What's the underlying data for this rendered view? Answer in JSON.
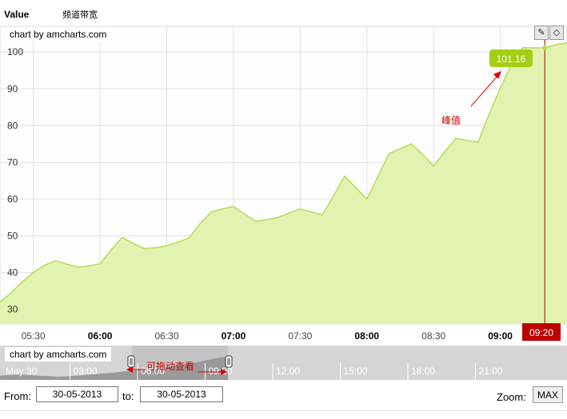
{
  "header": {
    "value_label": "Value",
    "legend_series": "频道带宽"
  },
  "credits": {
    "main": "chart by amcharts.com",
    "scroller": "chart by amcharts.com"
  },
  "tools": {
    "draw_icon": "pencil-icon",
    "erase_icon": "eraser-icon"
  },
  "annotations": {
    "peak_text": "峰值",
    "drag_text": "可拖动查看"
  },
  "cursor": {
    "time_label": "09:20",
    "value_label": "101.16"
  },
  "controls": {
    "from_label": "From:",
    "from_value": "30-05-2013",
    "to_label": "to:",
    "to_value": "30-05-2013",
    "zoom_label": "Zoom:",
    "max_label": "MAX"
  },
  "colors": {
    "area_fill": "#e2f2b0",
    "line": "#b7dc5a",
    "balloon": "#a2cf13",
    "cursor": "#aa0000",
    "annotation": "#dd0000"
  },
  "chart_data": {
    "type": "area",
    "series": [
      {
        "name": "频道带宽",
        "x": [
          "05:15",
          "05:20",
          "05:25",
          "05:30",
          "05:35",
          "05:40",
          "05:45",
          "05:50",
          "05:55",
          "06:00",
          "06:05",
          "06:10",
          "06:15",
          "06:20",
          "06:25",
          "06:30",
          "06:35",
          "06:40",
          "06:45",
          "06:50",
          "06:55",
          "07:00",
          "07:05",
          "07:10",
          "07:15",
          "07:20",
          "07:25",
          "07:30",
          "07:35",
          "07:40",
          "07:45",
          "07:50",
          "07:55",
          "08:00",
          "08:05",
          "08:10",
          "08:15",
          "08:20",
          "08:25",
          "08:30",
          "08:35",
          "08:40",
          "08:45",
          "08:50",
          "08:55",
          "09:00",
          "09:05",
          "09:10",
          "09:15",
          "09:20",
          "09:25",
          "09:30"
        ],
        "values": [
          32,
          34.5,
          37.5,
          40,
          42,
          43.2,
          42.3,
          41.5,
          41.8,
          42.4,
          46.2,
          49.6,
          47.9,
          46.5,
          46.8,
          47.3,
          48.3,
          49.4,
          53.3,
          56.5,
          57.3,
          58,
          55.9,
          54,
          54.4,
          55,
          56.2,
          57.3,
          56.5,
          55.7,
          60.9,
          66.2,
          63.1,
          60,
          66.2,
          72.4,
          73.7,
          75,
          72.2,
          69,
          72.9,
          76.5,
          76,
          75.5,
          83.2,
          90.2,
          96.6,
          101.16,
          101.16,
          101.16,
          102,
          102.5
        ]
      }
    ],
    "x_tick_labels": [
      "05:30",
      "06:00",
      "06:30",
      "07:00",
      "07:30",
      "08:00",
      "08:30",
      "09:00"
    ],
    "bold_ticks": [
      "06:00",
      "07:00",
      "08:00",
      "09:00"
    ],
    "y_ticks": [
      30,
      40,
      50,
      60,
      70,
      80,
      90,
      100
    ],
    "ylim": [
      26,
      107
    ],
    "scroller": {
      "labels": [
        "May 30",
        "03:00",
        "06:00",
        "09:00",
        "12:00",
        "15:00",
        "18:00",
        "21:00"
      ],
      "values": [
        34,
        36,
        38,
        37,
        35,
        33,
        32,
        30,
        31,
        33,
        35,
        38,
        40,
        42,
        45,
        48,
        51,
        53,
        55,
        58,
        62,
        66,
        70,
        75,
        80,
        86,
        92,
        98,
        101
      ]
    }
  }
}
